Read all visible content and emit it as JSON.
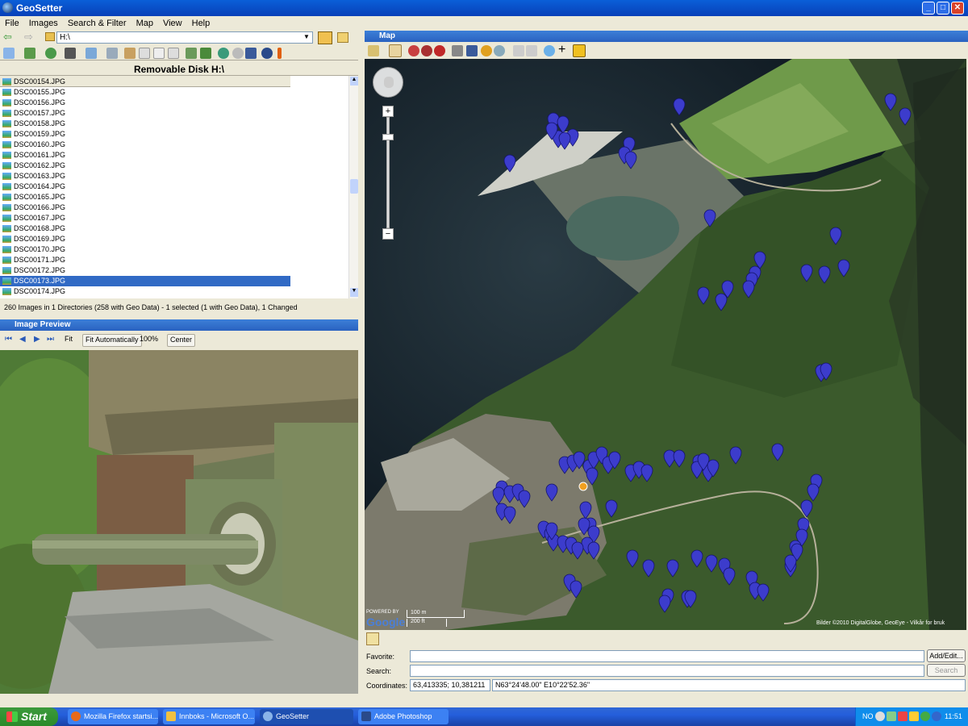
{
  "window": {
    "title": "GeoSetter",
    "min": "_",
    "max": "□",
    "close": "✕"
  },
  "menu": [
    "File",
    "Images",
    "Search & Filter",
    "Map",
    "View",
    "Help"
  ],
  "path": {
    "value": "H:\\"
  },
  "disk_header": "Removable Disk H:\\",
  "files": [
    "DSC00154.JPG",
    "DSC00155.JPG",
    "DSC00156.JPG",
    "DSC00157.JPG",
    "DSC00158.JPG",
    "DSC00159.JPG",
    "DSC00160.JPG",
    "DSC00161.JPG",
    "DSC00162.JPG",
    "DSC00163.JPG",
    "DSC00164.JPG",
    "DSC00165.JPG",
    "DSC00166.JPG",
    "DSC00167.JPG",
    "DSC00168.JPG",
    "DSC00169.JPG",
    "DSC00170.JPG",
    "DSC00171.JPG",
    "DSC00172.JPG",
    "DSC00173.JPG",
    "DSC00174.JPG"
  ],
  "selected_file": "DSC00173.JPG",
  "status": "260 Images in 1 Directories (258 with Geo Data) - 1 selected (1 with Geo Data), 1 Changed",
  "preview": {
    "title": "Image Preview",
    "fit": "Fit",
    "fit_auto": "Fit Automatically",
    "zoom": "100%",
    "center": "Center"
  },
  "map": {
    "title": "Map",
    "attribution": "Bilder ©2010 DigitalGlobe, GeoEye - Vilkår for bruk",
    "scale_m": "100 m",
    "scale_ft": "200 ft",
    "powered_by": "POWERED BY",
    "google": "Google"
  },
  "map_fields": {
    "favorite_label": "Favorite:",
    "add_edit": "Add/Edit...",
    "search_label": "Search:",
    "search_btn": "Search",
    "coordinates_label": "Coordinates:",
    "coord_decimal": "63,413335; 10,381211",
    "coord_dms": "N63°24'48.00\" E10°22'52.36\""
  },
  "taskbar": {
    "start": "Start",
    "tasks": [
      "Mozilla Firefox startsi...",
      "Innboks - Microsoft O...",
      "GeoSetter",
      "Adobe Photoshop"
    ],
    "lang": "NO",
    "clock": "11:51"
  },
  "colors": {
    "marker": "#3c3ccc",
    "selection": "#316ac5",
    "xp_blue": "#0a5fd8"
  }
}
